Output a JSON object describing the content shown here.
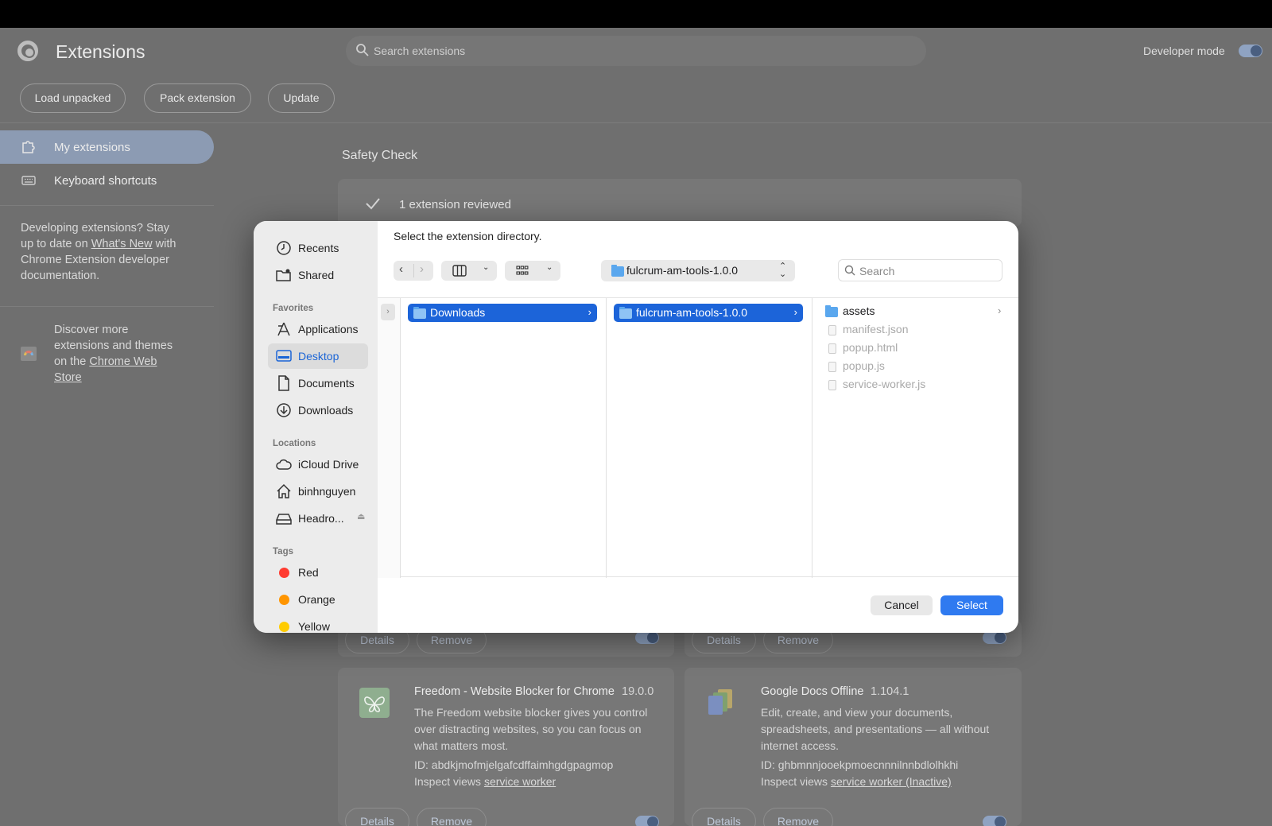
{
  "app": {
    "title": "Extensions",
    "search_placeholder": "Search extensions",
    "developer_mode_label": "Developer mode",
    "developer_mode_on": true
  },
  "toolbar": {
    "load_unpacked": "Load unpacked",
    "pack_extension": "Pack extension",
    "update": "Update"
  },
  "sidebar": {
    "items": [
      {
        "label": "My extensions",
        "icon": "puzzle-icon",
        "active": true
      },
      {
        "label": "Keyboard shortcuts",
        "icon": "keyboard-icon",
        "active": false
      }
    ],
    "dev_text_1": "Developing extensions? Stay",
    "dev_text_2a": "up to date on ",
    "dev_link": "What's New",
    "dev_text_2b": " with",
    "dev_text_3": "Chrome Extension developer",
    "dev_text_4": "documentation.",
    "store_text_1": "Discover more",
    "store_text_2": "extensions and themes",
    "store_text_3a": "on the ",
    "store_link_1": "Chrome Web",
    "store_link_2": "Store"
  },
  "safety_check": {
    "title": "Safety Check",
    "reviewed": "1 extension reviewed"
  },
  "cards": [
    {
      "details": "Details",
      "remove": "Remove"
    },
    {
      "details": "Details",
      "remove": "Remove"
    },
    {
      "name": "Freedom - Website Blocker for Chrome",
      "version": "19.0.0",
      "desc_1": "The Freedom website blocker gives you control",
      "desc_2": "over distracting websites, so you can focus on",
      "desc_3": "what matters most.",
      "id": "ID: abdkjmofmjelgafcdffaimhgdgpagmop",
      "inspect_label": "Inspect views ",
      "inspect_link": "service worker",
      "details": "Details",
      "remove": "Remove"
    },
    {
      "name": "Google Docs Offline",
      "version": "1.104.1",
      "desc_1": "Edit, create, and view your documents,",
      "desc_2": "spreadsheets, and presentations — all without",
      "desc_3": "internet access.",
      "id": "ID: ghbmnnjooekpmoecnnnilnnbdlolhkhi",
      "inspect_label": "Inspect views ",
      "inspect_link": "service worker (Inactive)",
      "details": "Details",
      "remove": "Remove"
    }
  ],
  "dialog": {
    "prompt": "Select the extension directory.",
    "sidebar": {
      "top": [
        {
          "label": "Recents",
          "icon": "clock-icon"
        },
        {
          "label": "Shared",
          "icon": "shared-folder-icon"
        }
      ],
      "favorites_label": "Favorites",
      "favorites": [
        {
          "label": "Applications",
          "icon": "applications-icon"
        },
        {
          "label": "Desktop",
          "icon": "desktop-icon",
          "active": true
        },
        {
          "label": "Documents",
          "icon": "document-icon"
        },
        {
          "label": "Downloads",
          "icon": "download-icon"
        }
      ],
      "locations_label": "Locations",
      "locations": [
        {
          "label": "iCloud Drive",
          "icon": "cloud-icon"
        },
        {
          "label": "binhnguyen",
          "icon": "home-icon"
        },
        {
          "label": "Headro...",
          "icon": "drive-icon"
        }
      ],
      "tags_label": "Tags",
      "tags": [
        {
          "label": "Red",
          "color": "#ff3b30"
        },
        {
          "label": "Orange",
          "color": "#ff9500"
        },
        {
          "label": "Yellow",
          "color": "#ffcc00"
        }
      ]
    },
    "path": "fulcrum-am-tools-1.0.0",
    "search_placeholder": "Search",
    "columns": {
      "col1_selected": "Downloads",
      "col2_selected": "fulcrum-am-tools-1.0.0",
      "col3_items": [
        {
          "label": "assets",
          "type": "folder"
        },
        {
          "label": "manifest.json",
          "type": "file"
        },
        {
          "label": "popup.html",
          "type": "file"
        },
        {
          "label": "popup.js",
          "type": "file"
        },
        {
          "label": "service-worker.js",
          "type": "file"
        }
      ]
    },
    "cancel": "Cancel",
    "select": "Select"
  },
  "colors": {
    "accent": "#1c64d9",
    "select_button": "#2f7af0"
  }
}
